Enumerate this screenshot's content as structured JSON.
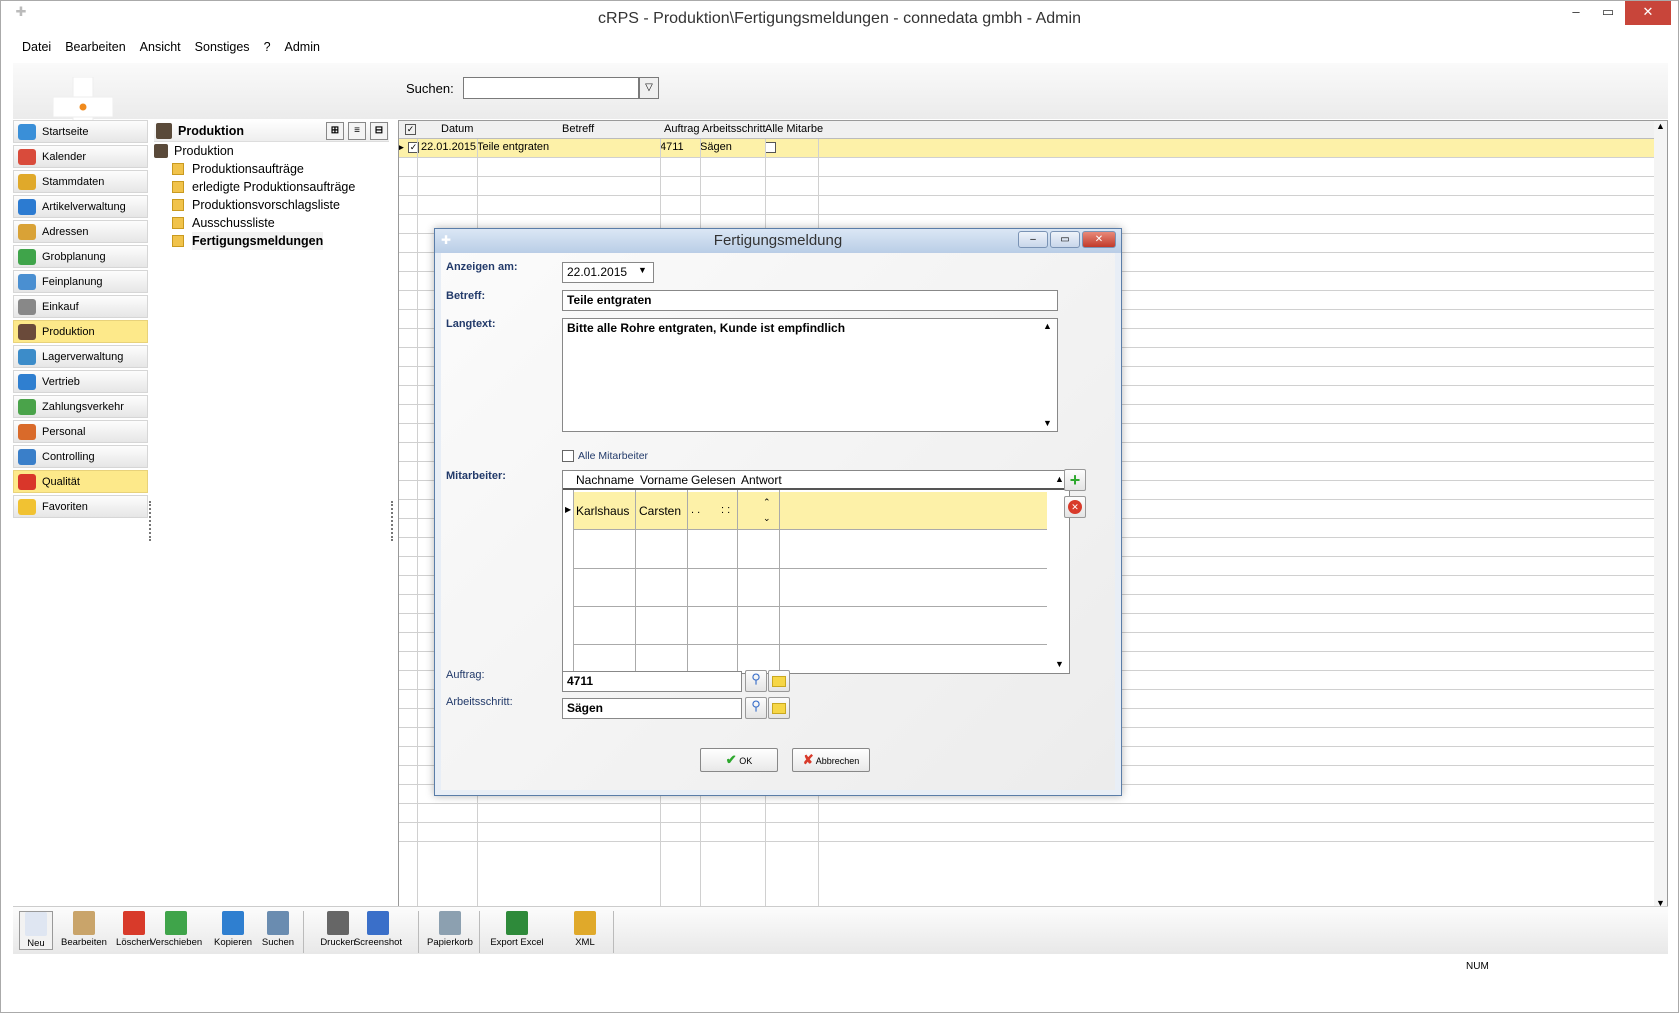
{
  "window": {
    "title": "cRPS - Produktion\\Fertigungsmeldungen - connedata gmbh - Admin"
  },
  "menu": [
    "Datei",
    "Bearbeiten",
    "Ansicht",
    "Sonstiges",
    "?",
    "Admin"
  ],
  "search": {
    "label": "Suchen:",
    "value": ""
  },
  "nav": [
    {
      "label": "Startseite",
      "icon": "home-icon",
      "color": "#3a8fd8"
    },
    {
      "label": "Kalender",
      "icon": "calendar-icon",
      "color": "#d94b3b"
    },
    {
      "label": "Stammdaten",
      "icon": "database-icon",
      "color": "#e0a92a"
    },
    {
      "label": "Artikelverwaltung",
      "icon": "box-icon",
      "color": "#2c7bd1"
    },
    {
      "label": "Adressen",
      "icon": "address-book-icon",
      "color": "#d9a236"
    },
    {
      "label": "Grobplanung",
      "icon": "chart-icon",
      "color": "#3fa44a"
    },
    {
      "label": "Feinplanung",
      "icon": "chart-detail-icon",
      "color": "#4a8fd1"
    },
    {
      "label": "Einkauf",
      "icon": "cart-icon",
      "color": "#888888"
    },
    {
      "label": "Produktion",
      "icon": "factory-icon",
      "color": "#6a4a3a",
      "selected": true
    },
    {
      "label": "Lagerverwaltung",
      "icon": "warehouse-icon",
      "color": "#3c8cc9"
    },
    {
      "label": "Vertrieb",
      "icon": "globe-icon",
      "color": "#2f7fd0"
    },
    {
      "label": "Zahlungsverkehr",
      "icon": "money-icon",
      "color": "#4aa34a"
    },
    {
      "label": "Personal",
      "icon": "people-icon",
      "color": "#d96a2a"
    },
    {
      "label": "Controlling",
      "icon": "bar-chart-icon",
      "color": "#3a7fc9"
    },
    {
      "label": "Qualität",
      "icon": "award-icon",
      "color": "#d9362a",
      "selected": true
    },
    {
      "label": "Favoriten",
      "icon": "star-icon",
      "color": "#f1c232"
    }
  ],
  "tree": {
    "header": "Produktion",
    "root": "Produktion",
    "children": [
      "Produktionsaufträge",
      "erledigte Produktionsaufträge",
      "Produktionsvorschlagsliste",
      "Ausschussliste",
      "Fertigungsmeldungen"
    ],
    "selected": "Fertigungsmeldungen"
  },
  "grid": {
    "columns": [
      "Datum",
      "Betreff",
      "Auftrag",
      "Arbeitsschritt",
      "Alle Mitarbe"
    ],
    "rows": [
      {
        "datum": "22.01.2015",
        "betreff": "Teile entgraten",
        "auftrag": "4711",
        "arbeitsschritt": "Sägen",
        "checked": true,
        "alle": false
      }
    ]
  },
  "bottom": [
    "Neu",
    "Bearbeiten",
    "Löschen",
    "Verschieben",
    "Kopieren",
    "Suchen",
    "Drucken",
    "Screenshot",
    "Papierkorb",
    "Export Excel",
    "XML"
  ],
  "status": {
    "num": "NUM"
  },
  "dialog": {
    "title": "Fertigungsmeldung",
    "anzeigen_label": "Anzeigen am:",
    "anzeigen_value": "22.01.2015",
    "betreff_label": "Betreff:",
    "betreff_value": "Teile entgraten",
    "langtext_label": "Langtext:",
    "langtext_value": "Bitte alle Rohre entgraten, Kunde ist empfindlich",
    "alle_label": "Alle Mitarbeiter",
    "mitarbeiter_label": "Mitarbeiter:",
    "mg_cols": [
      "Nachname",
      "Vorname",
      "Gelesen",
      "Antwort"
    ],
    "mg_row": {
      "nachname": "Karlshaus",
      "vorname": "Carsten",
      "gelesen": ". .",
      "antwort": ": :"
    },
    "auftrag_label": "Auftrag:",
    "auftrag_value": "4711",
    "schritt_label": "Arbeitsschritt:",
    "schritt_value": "Sägen",
    "ok": "OK",
    "cancel": "Abbrechen"
  }
}
